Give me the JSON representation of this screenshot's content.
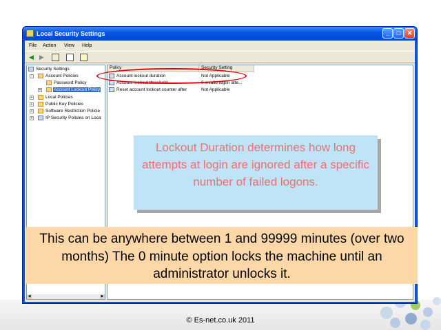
{
  "window": {
    "title": "Local Security Settings",
    "minimize": "_",
    "maximize": "□",
    "close": "✕"
  },
  "menu": {
    "items": [
      {
        "label": "File"
      },
      {
        "label": "Action"
      },
      {
        "label": "View"
      },
      {
        "label": "Help"
      }
    ]
  },
  "toolbar": {
    "buttons": [
      "back-arrow-icon",
      "forward-arrow-icon",
      "up-folder-icon",
      "properties-icon",
      "help-icon"
    ]
  },
  "tree": {
    "root": "Security Settings",
    "account_policies": "Account Policies",
    "password_policy": "Password Policy",
    "account_lockout_policy": "Account Lockout Policy",
    "local_policies": "Local Policies",
    "public_key_policies": "Public Key Policies",
    "software_restriction": "Software Restriction Policie",
    "ip_security": "IP Security Policies on Loca",
    "expand_minus": "-",
    "expand_plus": "+"
  },
  "list": {
    "columns": [
      "Policy",
      "Security Setting"
    ],
    "rows": [
      {
        "policy": "Account lockout duration",
        "setting": "Not Applicable"
      },
      {
        "policy": "Account lockout threshold",
        "setting": "0 invalid logon atte..."
      },
      {
        "policy": "Reset account lockout counter after",
        "setting": "Not Applicable"
      }
    ]
  },
  "callouts": {
    "blue": "Lockout Duration determines how long attempts at login are ignored after a specific number of failed logons.",
    "orange": "This can be anywhere between 1 and 99999 minutes (over two months) The 0 minute option locks the machine until an administrator unlocks it."
  },
  "footer": "© Es-net.co.uk 2011",
  "colors": {
    "titlebar": "#0a55e0",
    "callout_blue_bg": "#bfe3f7",
    "callout_blue_text": "#f07070",
    "callout_orange_bg": "#fcd8a8",
    "highlight_oval": "#e00010"
  }
}
